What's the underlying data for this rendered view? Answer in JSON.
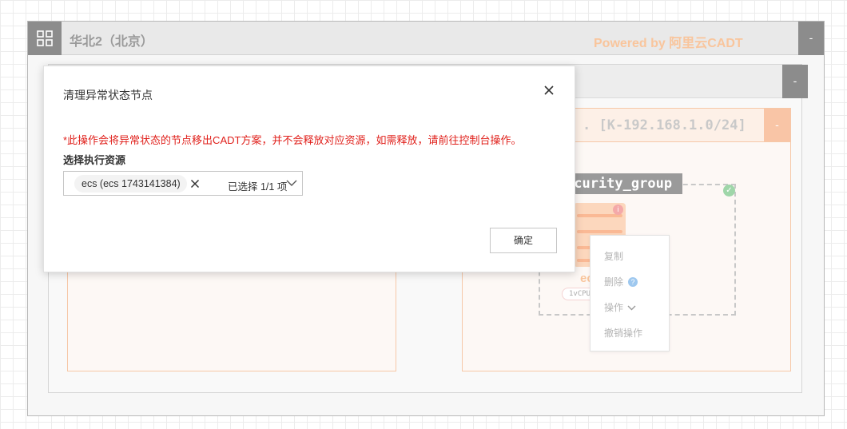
{
  "canvas": {
    "region_title": "华北2（北京）",
    "powered_by": "Powered by 阿里云CADT",
    "collapse_symbol": "-",
    "vswitch_title": ". [K-192.168.1.0/24]",
    "security_group_label": "ecurity_group",
    "ecs_node_text": "ec",
    "ecs_spec_text": "1vCPU"
  },
  "context_menu": {
    "items": [
      "复制",
      "删除",
      "操作",
      "撤销操作"
    ]
  },
  "dialog": {
    "title": "清理异常状态节点",
    "warning": "*此操作会将异常状态的节点移出CADT方案，并不会释放对应资源，如需释放，请前往控制台操作。",
    "resource_label": "选择执行资源",
    "selected_tag": "ecs (ecs 1743141384)",
    "selected_count": "已选择 1/1 项",
    "confirm_label": "确定"
  },
  "colors": {
    "accent_orange": "#f9c59c",
    "warning_red": "#e0201b",
    "help_blue": "#9ec8ef",
    "check_green": "#9fd6a9"
  },
  "icons": {
    "region": "grid-icon",
    "close": "close-icon",
    "tag_remove": "close-icon",
    "dropdown": "chevron-down-icon",
    "help": "question-icon",
    "status": "check-circle-icon",
    "info": "info-icon"
  }
}
